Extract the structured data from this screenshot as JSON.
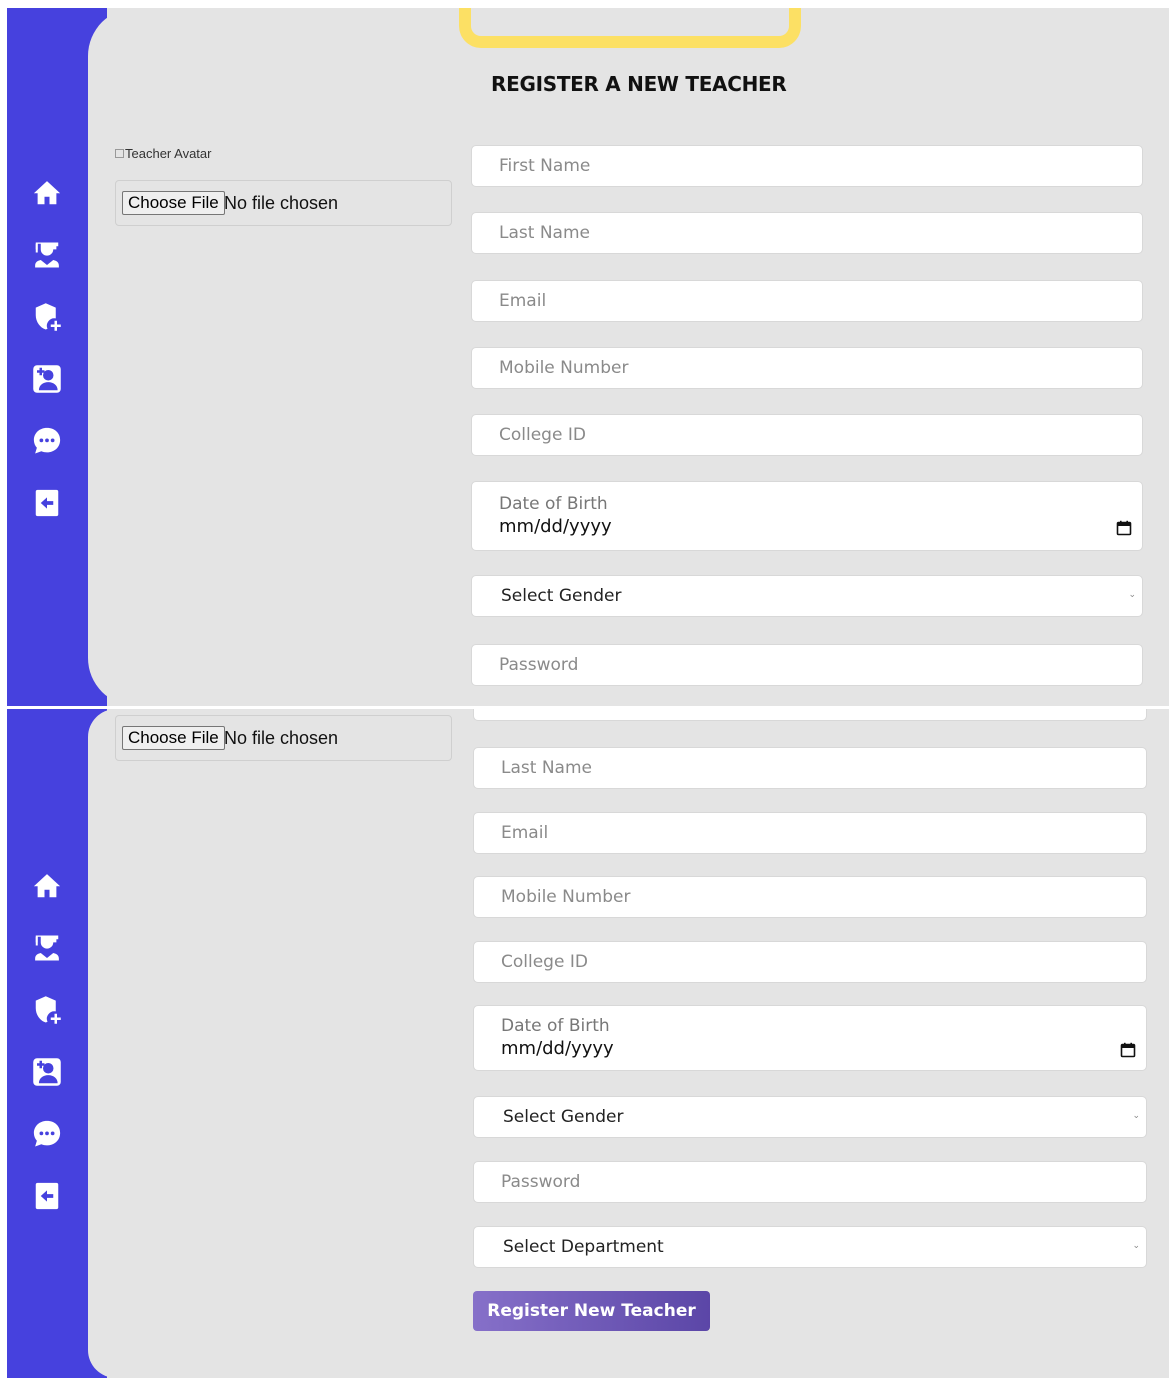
{
  "sidebar": {
    "items": [
      {
        "icon": "home-icon"
      },
      {
        "icon": "graduate-icon"
      },
      {
        "icon": "shield-plus-icon"
      },
      {
        "icon": "add-user-icon"
      },
      {
        "icon": "chat-icon"
      },
      {
        "icon": "logout-icon"
      }
    ]
  },
  "colors": {
    "sidebar": "#4641de",
    "background": "#e4e4e4",
    "accent_yellow": "#fce064",
    "button": "#6b56b7"
  },
  "form": {
    "title": "REGISTER A NEW TEACHER",
    "avatar_alt": "Teacher Avatar",
    "file_button": "Choose File",
    "file_status": "No file chosen",
    "first_name": "First Name",
    "last_name": "Last Name",
    "email": "Email",
    "mobile": "Mobile Number",
    "college_id": "College ID",
    "dob_label": "Date of Birth",
    "dob_value": "mm/dd/yyyy",
    "gender": "Select Gender",
    "password": "Password",
    "department": "Select Department",
    "submit": "Register New Teacher"
  }
}
